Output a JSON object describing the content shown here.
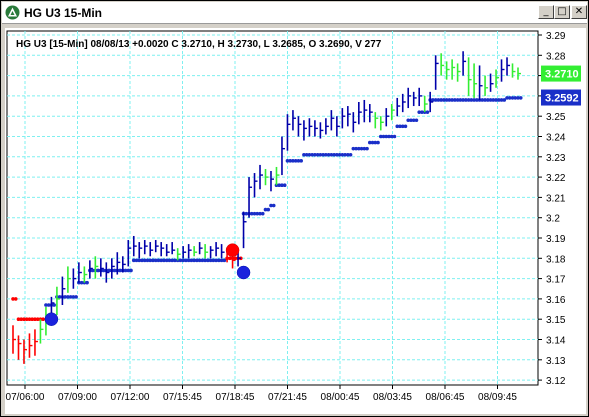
{
  "window": {
    "title": "HG U3 15-Min",
    "buttons": {
      "minimize": "_",
      "maximize": "□",
      "close": "✕"
    }
  },
  "header": {
    "info": "HG U3 [15-Min] 08/08/13  +0.0020 C 3.2710, H 3.2730, L 3.2685, O 3.2690, V 277"
  },
  "price_tags": {
    "last": {
      "text": "3.2710",
      "color": "#33ee33"
    },
    "stop": {
      "text": "3.2592",
      "color": "#1a2fc8"
    }
  },
  "colors": {
    "grid": "#7ff0f0",
    "up": "#33ee33",
    "down": "#ff0000",
    "neutral": "#0000aa",
    "stop_dots": "#1a2fc8"
  },
  "chart_data": {
    "type": "line",
    "ylim": [
      3.12,
      3.29
    ],
    "y_ticks": [
      "3.29",
      "3.28",
      "3.27",
      "3.26",
      "3.25",
      "3.24",
      "3.23",
      "3.22",
      "3.21",
      "3.2",
      "3.19",
      "3.18",
      "3.17",
      "3.16",
      "3.15",
      "3.14",
      "3.13",
      "3.12"
    ],
    "x_ticks": [
      "07/06:00",
      "07/09:00",
      "07/12:00",
      "07/15:45",
      "07/18:45",
      "07/21:45",
      "08/00:45",
      "08/03:45",
      "08/06:45",
      "08/09:45"
    ],
    "series": [
      {
        "role": "price_bars",
        "values": [
          [
            3.147,
            3.133,
            3.14,
            "r"
          ],
          [
            3.142,
            3.13,
            3.138,
            "r"
          ],
          [
            3.14,
            3.128,
            3.135,
            "r"
          ],
          [
            3.143,
            3.131,
            3.137,
            "r"
          ],
          [
            3.145,
            3.132,
            3.139,
            "r"
          ],
          [
            3.15,
            3.138,
            3.145,
            "g"
          ],
          [
            3.156,
            3.142,
            3.152,
            "g"
          ],
          [
            3.161,
            3.149,
            3.158,
            "b"
          ],
          [
            3.166,
            3.152,
            3.16,
            "g"
          ],
          [
            3.171,
            3.157,
            3.165,
            "b"
          ],
          [
            3.176,
            3.163,
            3.17,
            "g"
          ],
          [
            3.175,
            3.165,
            3.17,
            "b"
          ],
          [
            3.178,
            3.168,
            3.173,
            "b"
          ],
          [
            3.176,
            3.168,
            3.172,
            "g"
          ],
          [
            3.179,
            3.17,
            3.175,
            "b"
          ],
          [
            3.181,
            3.17,
            3.176,
            "g"
          ],
          [
            3.18,
            3.171,
            3.175,
            "b"
          ],
          [
            3.178,
            3.168,
            3.173,
            "b"
          ],
          [
            3.18,
            3.17,
            3.176,
            "b"
          ],
          [
            3.183,
            3.172,
            3.178,
            "b"
          ],
          [
            3.181,
            3.173,
            3.177,
            "b"
          ],
          [
            3.189,
            3.176,
            3.185,
            "b"
          ],
          [
            3.191,
            3.181,
            3.186,
            "b"
          ],
          [
            3.188,
            3.18,
            3.185,
            "b"
          ],
          [
            3.189,
            3.182,
            3.186,
            "b"
          ],
          [
            3.188,
            3.181,
            3.184,
            "b"
          ],
          [
            3.189,
            3.183,
            3.186,
            "b"
          ],
          [
            3.188,
            3.181,
            3.185,
            "b"
          ],
          [
            3.187,
            3.181,
            3.183,
            "b"
          ],
          [
            3.188,
            3.182,
            3.184,
            "b"
          ],
          [
            3.185,
            3.179,
            3.182,
            "g"
          ],
          [
            3.186,
            3.18,
            3.183,
            "b"
          ],
          [
            3.187,
            3.18,
            3.184,
            "b"
          ],
          [
            3.186,
            3.181,
            3.183,
            "g"
          ],
          [
            3.188,
            3.182,
            3.185,
            "b"
          ],
          [
            3.187,
            3.18,
            3.183,
            "g"
          ],
          [
            3.186,
            3.18,
            3.184,
            "b"
          ],
          [
            3.188,
            3.181,
            3.185,
            "b"
          ],
          [
            3.187,
            3.18,
            3.183,
            "b"
          ],
          [
            3.185,
            3.178,
            3.182,
            "r"
          ],
          [
            3.182,
            3.175,
            3.179,
            "r"
          ],
          [
            3.184,
            3.176,
            3.18,
            "b"
          ],
          [
            3.203,
            3.185,
            3.198,
            "b"
          ],
          [
            3.22,
            3.2,
            3.215,
            "b"
          ],
          [
            3.222,
            3.21,
            3.218,
            "b"
          ],
          [
            3.226,
            3.214,
            3.221,
            "b"
          ],
          [
            3.224,
            3.216,
            3.22,
            "g"
          ],
          [
            3.223,
            3.213,
            3.219,
            "b"
          ],
          [
            3.225,
            3.216,
            3.221,
            "g"
          ],
          [
            3.24,
            3.221,
            3.234,
            "b"
          ],
          [
            3.251,
            3.233,
            3.246,
            "b"
          ],
          [
            3.253,
            3.243,
            3.249,
            "b"
          ],
          [
            3.25,
            3.24,
            3.246,
            "b"
          ],
          [
            3.248,
            3.238,
            3.244,
            "b"
          ],
          [
            3.249,
            3.24,
            3.245,
            "b"
          ],
          [
            3.248,
            3.24,
            3.244,
            "b"
          ],
          [
            3.247,
            3.239,
            3.243,
            "b"
          ],
          [
            3.249,
            3.241,
            3.245,
            "b"
          ],
          [
            3.253,
            3.243,
            3.249,
            "b"
          ],
          [
            3.25,
            3.24,
            3.245,
            "b"
          ],
          [
            3.254,
            3.244,
            3.25,
            "b"
          ],
          [
            3.255,
            3.245,
            3.251,
            "b"
          ],
          [
            3.252,
            3.242,
            3.247,
            "b"
          ],
          [
            3.257,
            3.246,
            3.252,
            "b"
          ],
          [
            3.258,
            3.247,
            3.253,
            "b"
          ],
          [
            3.256,
            3.247,
            3.252,
            "b"
          ],
          [
            3.252,
            3.244,
            3.249,
            "g"
          ],
          [
            3.25,
            3.243,
            3.247,
            "g"
          ],
          [
            3.254,
            3.245,
            3.25,
            "b"
          ],
          [
            3.256,
            3.248,
            3.253,
            "g"
          ],
          [
            3.259,
            3.25,
            3.255,
            "b"
          ],
          [
            3.261,
            3.252,
            3.257,
            "b"
          ],
          [
            3.264,
            3.254,
            3.26,
            "b"
          ],
          [
            3.262,
            3.255,
            3.259,
            "b"
          ],
          [
            3.264,
            3.255,
            3.26,
            "b"
          ],
          [
            3.26,
            3.252,
            3.256,
            "g"
          ],
          [
            3.262,
            3.252,
            3.257,
            "b"
          ],
          [
            3.28,
            3.263,
            3.276,
            "b"
          ],
          [
            3.281,
            3.27,
            3.275,
            "g"
          ],
          [
            3.277,
            3.268,
            3.273,
            "g"
          ],
          [
            3.278,
            3.268,
            3.274,
            "g"
          ],
          [
            3.276,
            3.267,
            3.272,
            "g"
          ],
          [
            3.282,
            3.27,
            3.277,
            "b"
          ],
          [
            3.279,
            3.26,
            3.268,
            "g"
          ],
          [
            3.276,
            3.259,
            3.266,
            "g"
          ],
          [
            3.275,
            3.258,
            3.265,
            "b"
          ],
          [
            3.27,
            3.26,
            3.264,
            "g"
          ],
          [
            3.271,
            3.262,
            3.266,
            "b"
          ],
          [
            3.273,
            3.264,
            3.269,
            "g"
          ],
          [
            3.278,
            3.267,
            3.273,
            "b"
          ],
          [
            3.279,
            3.27,
            3.275,
            "b"
          ],
          [
            3.276,
            3.269,
            3.272,
            "g"
          ],
          [
            3.274,
            3.268,
            3.271,
            "g"
          ]
        ]
      },
      {
        "role": "stop_dots",
        "values": [
          [
            0,
            3.16,
            "r"
          ],
          [
            1,
            3.15,
            "r"
          ],
          [
            2,
            3.15,
            "r"
          ],
          [
            3,
            3.15,
            "r"
          ],
          [
            4,
            3.15,
            "r"
          ],
          [
            5,
            3.15,
            "r"
          ],
          [
            6,
            3.157,
            "b"
          ],
          [
            7,
            3.157,
            "b"
          ],
          [
            8,
            3.161,
            "b"
          ],
          [
            9,
            3.161,
            "b"
          ],
          [
            10,
            3.161,
            "b"
          ],
          [
            11,
            3.161,
            "b"
          ],
          [
            12,
            3.168,
            "b"
          ],
          [
            13,
            3.168,
            "b"
          ],
          [
            14,
            3.174,
            "b"
          ],
          [
            15,
            3.174,
            "b"
          ],
          [
            16,
            3.174,
            "b"
          ],
          [
            17,
            3.174,
            "b"
          ],
          [
            18,
            3.174,
            "b"
          ],
          [
            19,
            3.174,
            "b"
          ],
          [
            20,
            3.174,
            "b"
          ],
          [
            21,
            3.174,
            "b"
          ],
          [
            22,
            3.179,
            "b"
          ],
          [
            23,
            3.179,
            "b"
          ],
          [
            24,
            3.179,
            "b"
          ],
          [
            25,
            3.179,
            "b"
          ],
          [
            26,
            3.179,
            "b"
          ],
          [
            27,
            3.179,
            "b"
          ],
          [
            28,
            3.179,
            "b"
          ],
          [
            29,
            3.179,
            "b"
          ],
          [
            30,
            3.179,
            "b"
          ],
          [
            31,
            3.179,
            "b"
          ],
          [
            32,
            3.179,
            "b"
          ],
          [
            33,
            3.179,
            "b"
          ],
          [
            34,
            3.179,
            "b"
          ],
          [
            35,
            3.179,
            "b"
          ],
          [
            36,
            3.179,
            "b"
          ],
          [
            37,
            3.179,
            "b"
          ],
          [
            38,
            3.179,
            "b"
          ],
          [
            39,
            3.18,
            "r"
          ],
          [
            40,
            3.18,
            "r"
          ],
          [
            41,
            3.18,
            "r"
          ],
          [
            42,
            3.202,
            "b"
          ],
          [
            43,
            3.202,
            "b"
          ],
          [
            44,
            3.202,
            "b"
          ],
          [
            45,
            3.202,
            "b"
          ],
          [
            46,
            3.204,
            "b"
          ],
          [
            47,
            3.206,
            "b"
          ],
          [
            48,
            3.216,
            "b"
          ],
          [
            49,
            3.216,
            "b"
          ],
          [
            50,
            3.228,
            "b"
          ],
          [
            51,
            3.228,
            "b"
          ],
          [
            52,
            3.228,
            "b"
          ],
          [
            53,
            3.231,
            "b"
          ],
          [
            54,
            3.231,
            "b"
          ],
          [
            55,
            3.231,
            "b"
          ],
          [
            56,
            3.231,
            "b"
          ],
          [
            57,
            3.231,
            "b"
          ],
          [
            58,
            3.231,
            "b"
          ],
          [
            59,
            3.231,
            "b"
          ],
          [
            60,
            3.231,
            "b"
          ],
          [
            61,
            3.231,
            "b"
          ],
          [
            62,
            3.234,
            "b"
          ],
          [
            63,
            3.234,
            "b"
          ],
          [
            64,
            3.234,
            "b"
          ],
          [
            65,
            3.237,
            "b"
          ],
          [
            66,
            3.237,
            "b"
          ],
          [
            67,
            3.24,
            "b"
          ],
          [
            68,
            3.24,
            "b"
          ],
          [
            69,
            3.24,
            "b"
          ],
          [
            70,
            3.245,
            "b"
          ],
          [
            71,
            3.245,
            "b"
          ],
          [
            72,
            3.248,
            "b"
          ],
          [
            73,
            3.248,
            "b"
          ],
          [
            74,
            3.252,
            "b"
          ],
          [
            75,
            3.252,
            "b"
          ],
          [
            76,
            3.258,
            "b"
          ],
          [
            77,
            3.258,
            "b"
          ],
          [
            78,
            3.258,
            "b"
          ],
          [
            79,
            3.258,
            "b"
          ],
          [
            80,
            3.258,
            "b"
          ],
          [
            81,
            3.258,
            "b"
          ],
          [
            82,
            3.258,
            "b"
          ],
          [
            83,
            3.258,
            "b"
          ],
          [
            84,
            3.258,
            "b"
          ],
          [
            85,
            3.258,
            "b"
          ],
          [
            86,
            3.258,
            "b"
          ],
          [
            87,
            3.258,
            "b"
          ],
          [
            88,
            3.258,
            "b"
          ],
          [
            89,
            3.258,
            "b"
          ],
          [
            90,
            3.259,
            "b"
          ],
          [
            91,
            3.259,
            "b"
          ],
          [
            92,
            3.259,
            "b"
          ]
        ]
      },
      {
        "role": "signal_markers",
        "values": [
          [
            7,
            3.15,
            "b"
          ],
          [
            40,
            3.184,
            "r"
          ],
          [
            42,
            3.173,
            "b"
          ]
        ]
      }
    ]
  }
}
